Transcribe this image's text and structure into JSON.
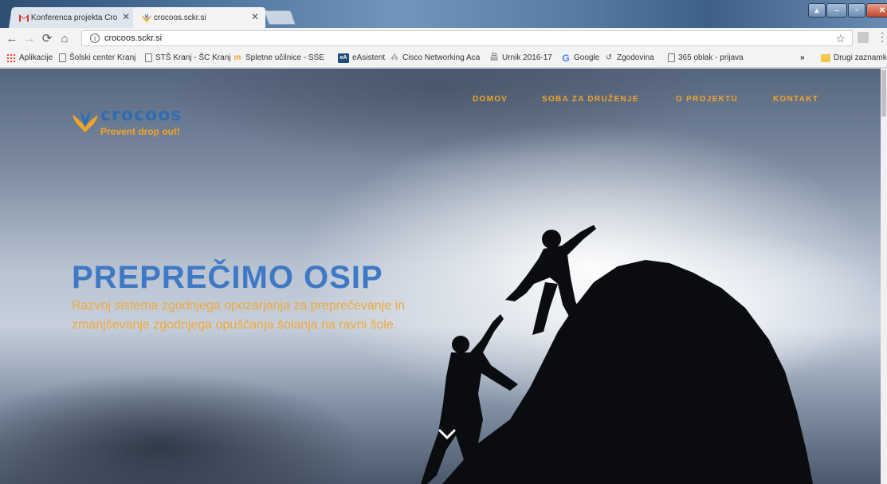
{
  "tabs": [
    {
      "title": "Konferenca projekta Cro",
      "favicon": "gmail-icon",
      "active": false
    },
    {
      "title": "crocoos.sckr.si",
      "favicon": "crocoos-icon",
      "active": true
    }
  ],
  "toolbar": {
    "url": "crocoos.sckr.si",
    "info_glyph": "i"
  },
  "bookmarks": [
    {
      "label": "Aplikacije",
      "icon": "apps-grid-icon"
    },
    {
      "label": "Šolski center Kranj",
      "icon": "page-icon"
    },
    {
      "label": "STŠ Kranj - ŠC Kranj",
      "icon": "page-icon"
    },
    {
      "label": "Spletne učilnice - SŠE",
      "icon": "moodle-icon"
    },
    {
      "label": "eAsistent",
      "icon": "easistent-icon",
      "badge": "eA"
    },
    {
      "label": "Cisco Networking Aca",
      "icon": "cisco-icon"
    },
    {
      "label": "Urnik 2016-17",
      "icon": "network-icon"
    },
    {
      "label": "Google",
      "icon": "google-icon",
      "badge": "G"
    },
    {
      "label": "Zgodovina",
      "icon": "history-icon"
    },
    {
      "label": "365 oblak - prijava",
      "icon": "page-icon"
    },
    {
      "label": "Drugi zaznamki",
      "icon": "folder-icon"
    }
  ],
  "bookmarks_overflow": "»",
  "site": {
    "logo_word": "crocoos",
    "logo_tagline": "Prevent drop out!",
    "nav": [
      "DOMOV",
      "SOBA ZA DRUŽENJE",
      "O PROJEKTU",
      "KONTAKT"
    ],
    "headline": "PREPREČIMO OSIP",
    "subheadline": "Razvoj sistema zgodnjega opozarjanja za preprečevanje in zmanjševanje zgodnjega opuščanja šolanja na ravni šole."
  },
  "colors": {
    "accent_orange": "#f0a52a",
    "brand_blue": "#3f78c4"
  }
}
